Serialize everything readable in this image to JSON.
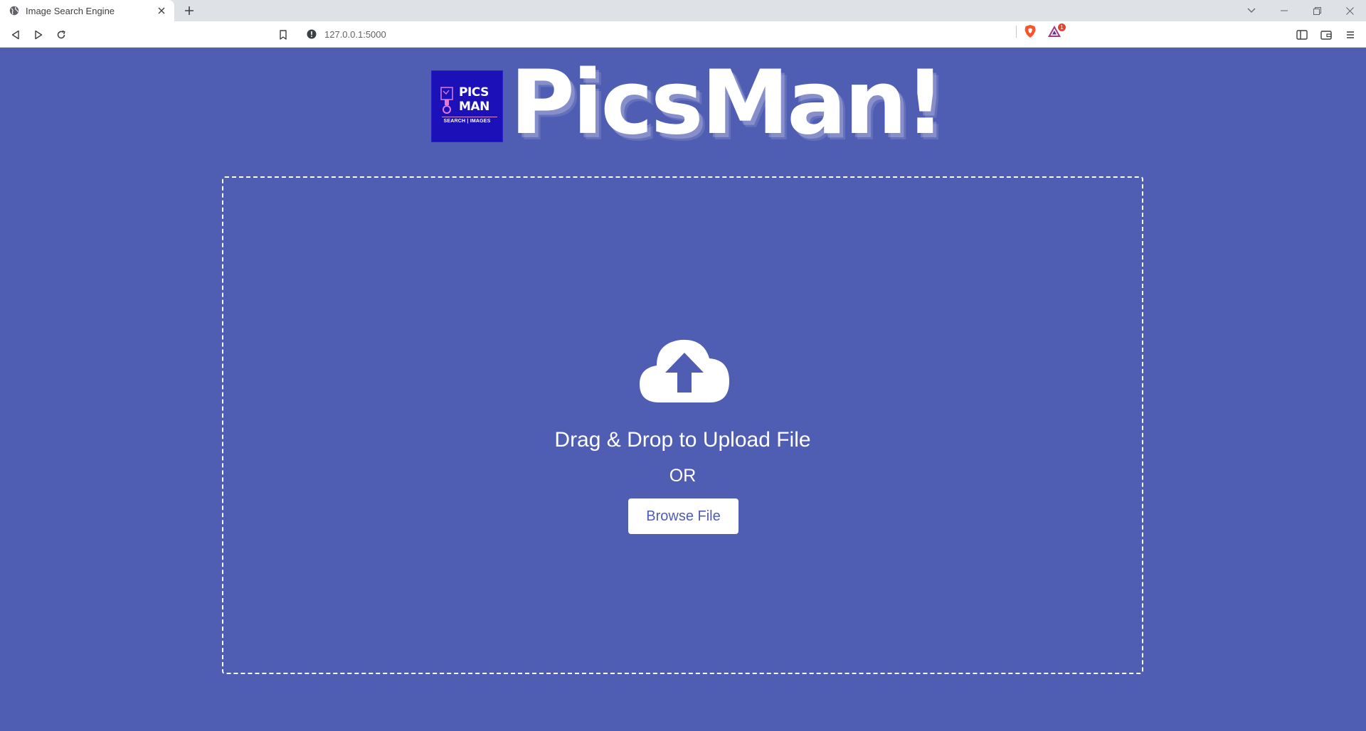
{
  "browser": {
    "tab_title": "Image Search Engine",
    "url": "127.0.0.1:5000",
    "rewards_badge_count": "1"
  },
  "logo": {
    "box_line1": "PICS",
    "box_line2": "MAN",
    "box_tagline": "SEARCH | IMAGES",
    "wordmark": "PicsMan!"
  },
  "upload": {
    "title": "Drag & Drop to Upload File",
    "or_text": "OR",
    "browse_label": "Browse File"
  },
  "colors": {
    "page_background": "#4f5db3",
    "logo_box": "#1c11b8",
    "button_text": "#4f5db3",
    "text": "#ffffff"
  }
}
